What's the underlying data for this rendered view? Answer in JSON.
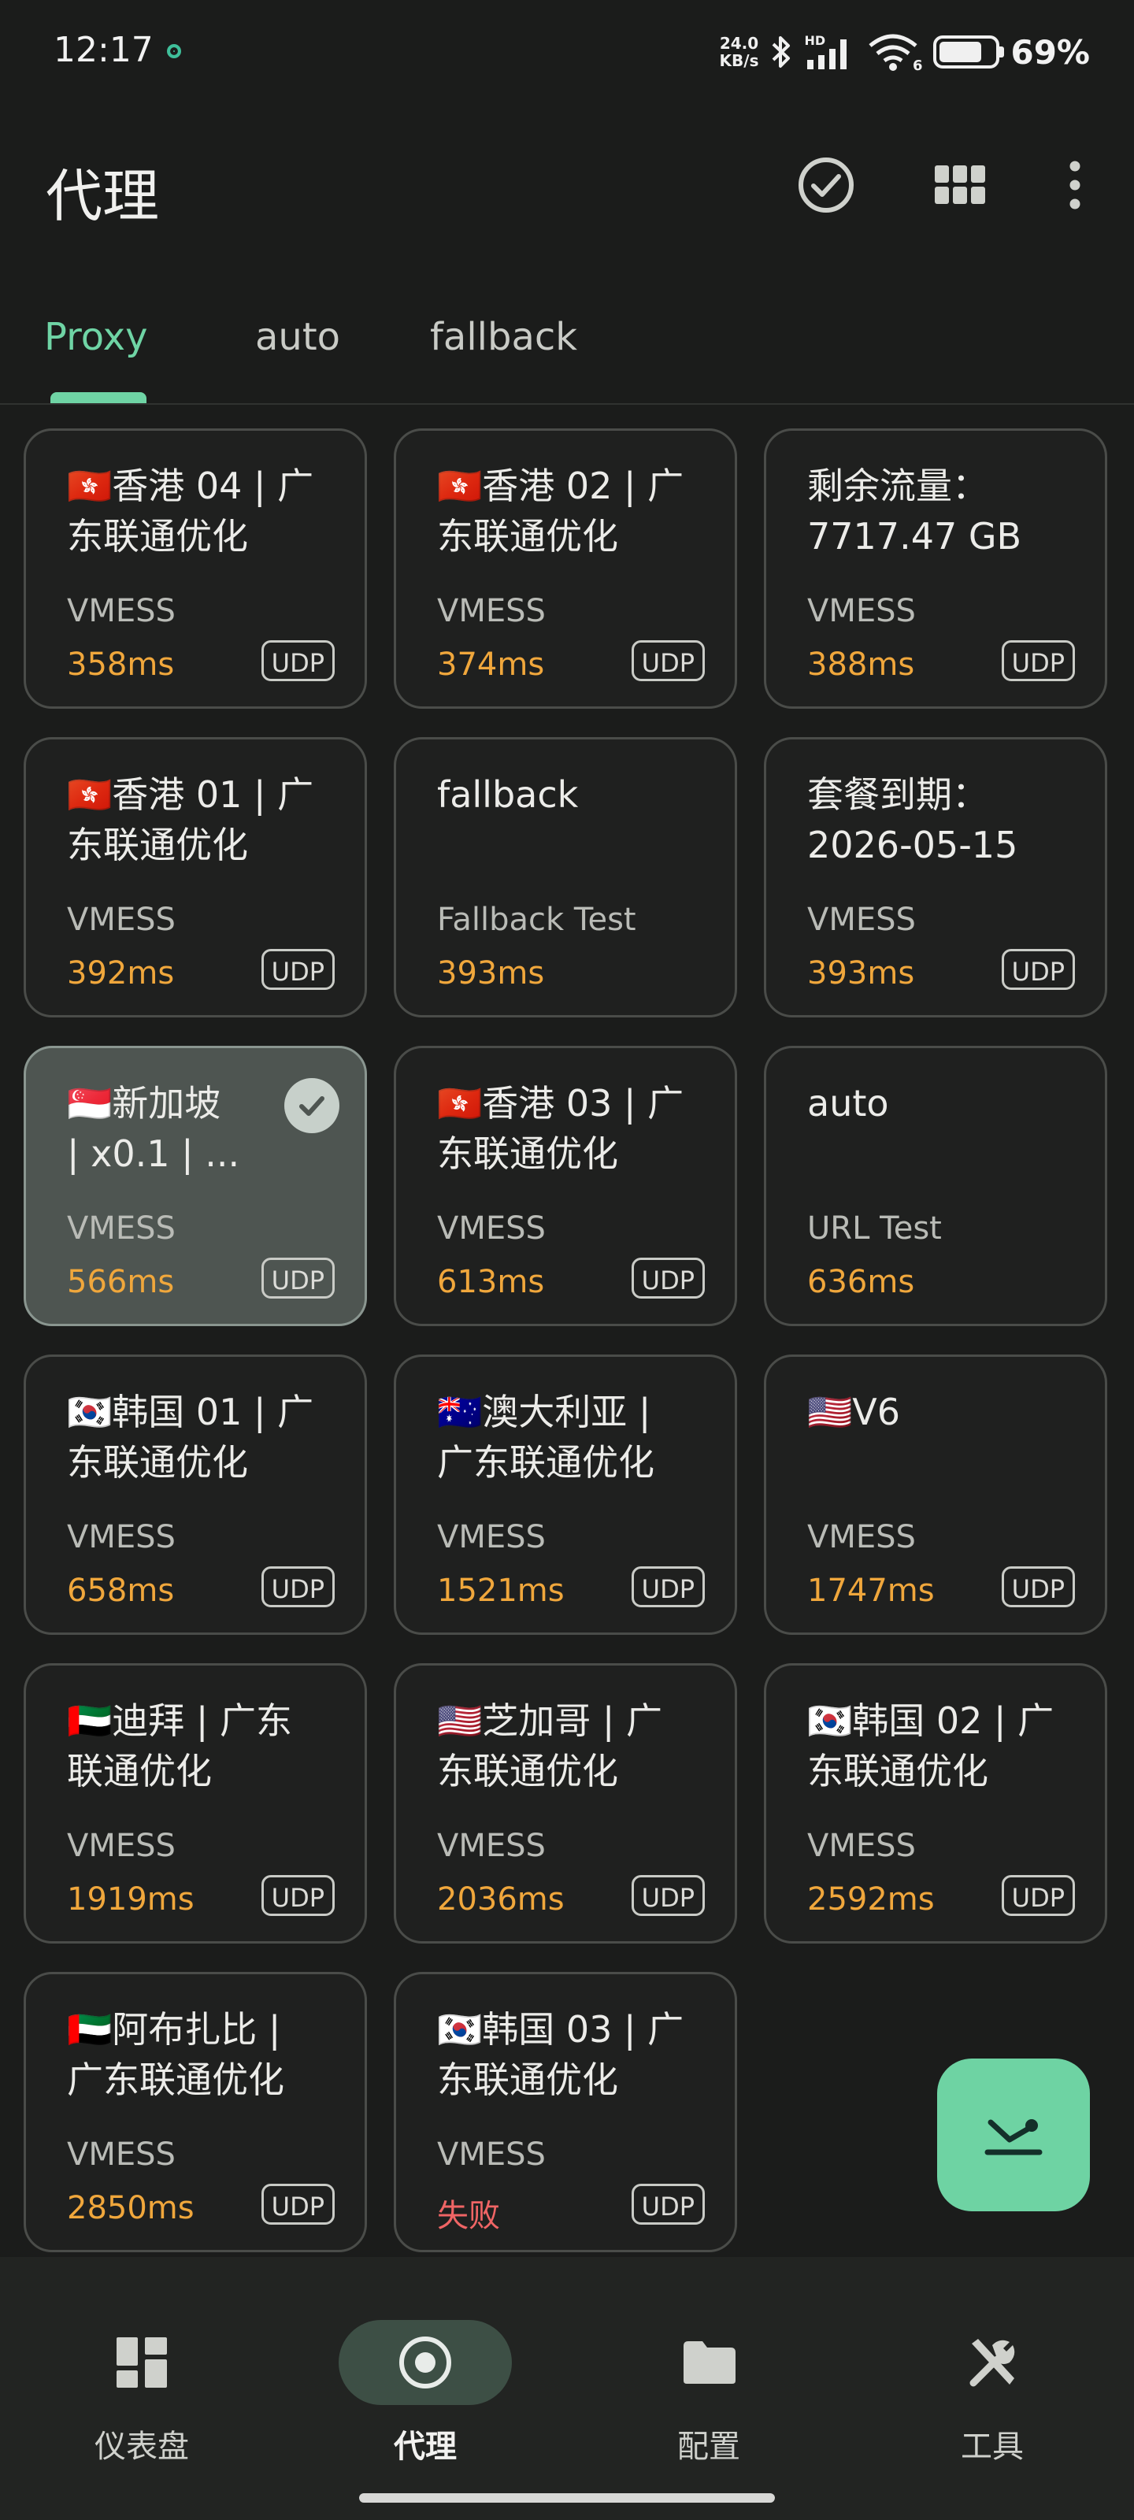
{
  "status_bar": {
    "time": "12:17",
    "speed_value": "24.0",
    "speed_unit": "KB/s",
    "hd_label": "HD",
    "wifi_label": "6",
    "battery_percent": "69%",
    "battery_level": 0.69
  },
  "app_bar": {
    "title": "代理"
  },
  "tabs": [
    {
      "label": "Proxy",
      "active": true
    },
    {
      "label": "auto",
      "active": false
    },
    {
      "label": "fallback",
      "active": false
    }
  ],
  "cards": [
    {
      "name": "🇭🇰香港 04 | 广\n东联通优化",
      "type": "VMESS",
      "delay": "358ms",
      "udp": "UDP"
    },
    {
      "name": "🇭🇰香港 02 | 广\n东联通优化",
      "type": "VMESS",
      "delay": "374ms",
      "udp": "UDP"
    },
    {
      "name": "剩余流量：\n7717.47 GB",
      "type": "VMESS",
      "delay": "388ms",
      "udp": "UDP"
    },
    {
      "name": "🇭🇰香港 01 | 广\n东联通优化",
      "type": "VMESS",
      "delay": "392ms",
      "udp": "UDP"
    },
    {
      "name": "fallback",
      "type": "Fallback Test",
      "delay": "393ms",
      "udp": ""
    },
    {
      "name": "套餐到期：\n2026-05-15",
      "type": "VMESS",
      "delay": "393ms",
      "udp": "UDP"
    },
    {
      "name": "🇸🇬新加坡\n| x0.1 | ...",
      "type": "VMESS",
      "delay": "566ms",
      "udp": "UDP",
      "selected": true
    },
    {
      "name": "🇭🇰香港 03 | 广\n东联通优化",
      "type": "VMESS",
      "delay": "613ms",
      "udp": "UDP"
    },
    {
      "name": "auto",
      "type": "URL Test",
      "delay": "636ms",
      "udp": ""
    },
    {
      "name": "🇰🇷韩国 01 | 广\n东联通优化",
      "type": "VMESS",
      "delay": "658ms",
      "udp": "UDP"
    },
    {
      "name": "🇦🇺澳大利亚 |\n广东联通优化",
      "type": "VMESS",
      "delay": "1521ms",
      "udp": "UDP"
    },
    {
      "name": "🇺🇸V6",
      "type": "VMESS",
      "delay": "1747ms",
      "udp": "UDP"
    },
    {
      "name": "🇦🇪迪拜 | 广东\n联通优化",
      "type": "VMESS",
      "delay": "1919ms",
      "udp": "UDP"
    },
    {
      "name": "🇺🇸芝加哥 | 广\n东联通优化",
      "type": "VMESS",
      "delay": "2036ms",
      "udp": "UDP"
    },
    {
      "name": "🇰🇷韩国 02 | 广\n东联通优化",
      "type": "VMESS",
      "delay": "2592ms",
      "udp": "UDP"
    },
    {
      "name": "🇦🇪阿布扎比 |\n广东联通优化",
      "type": "VMESS",
      "delay": "2850ms",
      "udp": "UDP"
    },
    {
      "name": "🇰🇷韩国 03 | 广\n东联通优化",
      "type": "VMESS",
      "delay": "失败",
      "udp": "UDP",
      "failed": true
    }
  ],
  "nav": [
    {
      "label": "仪表盘",
      "icon": "dashboard-icon",
      "active": false
    },
    {
      "label": "代理",
      "icon": "proxy-icon",
      "active": true
    },
    {
      "label": "配置",
      "icon": "folder-icon",
      "active": false
    },
    {
      "label": "工具",
      "icon": "tools-icon",
      "active": false
    }
  ],
  "colors": {
    "accent": "#6fd4a5",
    "delay": "#f0a73c",
    "fail": "#f06565",
    "background": "#1b1c1b"
  }
}
